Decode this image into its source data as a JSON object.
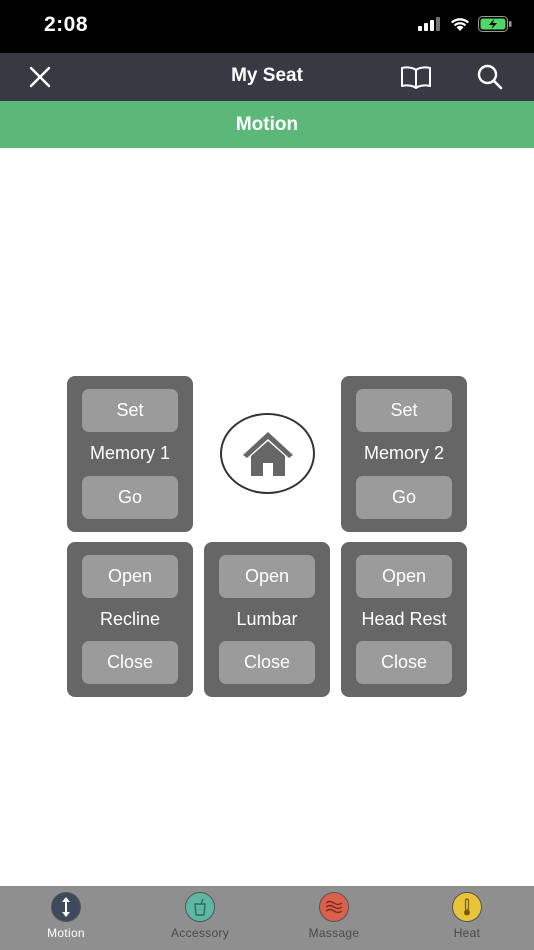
{
  "status": {
    "time": "2:08"
  },
  "nav": {
    "title": "My Seat"
  },
  "section": {
    "title": "Motion"
  },
  "memory1": {
    "set": "Set",
    "label": "Memory 1",
    "go": "Go"
  },
  "memory2": {
    "set": "Set",
    "label": "Memory 2",
    "go": "Go"
  },
  "recline": {
    "open": "Open",
    "label": "Recline",
    "close": "Close"
  },
  "lumbar": {
    "open": "Open",
    "label": "Lumbar",
    "close": "Close"
  },
  "headrest": {
    "open": "Open",
    "label": "Head Rest",
    "close": "Close"
  },
  "tabs": [
    {
      "label": "Motion",
      "icon": "motion-icon",
      "color": "#3c4a5c",
      "active": true
    },
    {
      "label": "Accessory",
      "icon": "cup-icon",
      "color": "#5cb8a4",
      "active": false
    },
    {
      "label": "Massage",
      "icon": "massage-icon",
      "color": "#d9604a",
      "active": false
    },
    {
      "label": "Heat",
      "icon": "thermometer-icon",
      "color": "#e8c438",
      "active": false
    }
  ],
  "colors": {
    "nav": "#353a43",
    "section": "#5cb878",
    "panel": "#666666",
    "button": "#9b9b9b",
    "tabbar": "#8f8f8f"
  }
}
